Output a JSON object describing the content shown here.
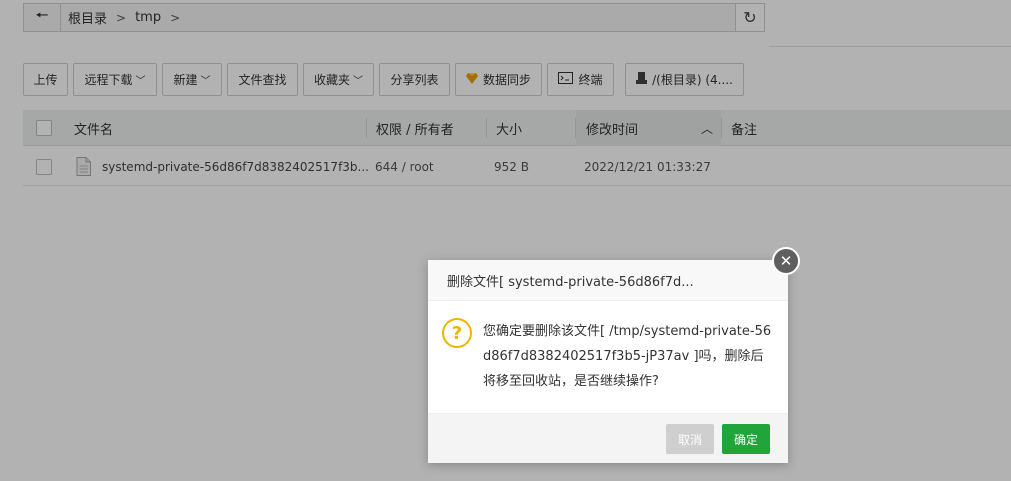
{
  "pathbar": {
    "back_icon": "arrow-left-icon",
    "crumbs": [
      "根目录",
      "tmp"
    ],
    "separator": ">",
    "refresh_icon": "refresh-icon"
  },
  "toolbar": {
    "upload": "上传",
    "remote_download": "远程下载",
    "new": "新建",
    "file_search": "文件查找",
    "favorites": "收藏夹",
    "share_list": "分享列表",
    "data_sync": "数据同步",
    "terminal": "终端",
    "disk": "/(根目录) (4...."
  },
  "table": {
    "headers": {
      "name": "文件名",
      "permission": "权限 / 所有者",
      "size": "大小",
      "modified": "修改时间",
      "note": "备注"
    },
    "rows": [
      {
        "name": "systemd-private-56d86f7d8382402517f3b...",
        "permission": "644 / root",
        "size": "952 B",
        "modified": "2022/12/21 01:33:27",
        "note": ""
      }
    ]
  },
  "dialog": {
    "title": "删除文件[ systemd-private-56d86f7d...",
    "message": "您确定要删除该文件[ /tmp/systemd-private-56d86f7d8382402517f3b5-jP37av ]吗，删除后将移至回收站，是否继续操作?",
    "cancel": "取消",
    "confirm": "确定",
    "icon": "question-icon",
    "close_icon": "close-icon"
  },
  "colors": {
    "accent_green": "#20a53a",
    "warning_yellow": "#f0b400",
    "sync_icon": "#f0a000"
  }
}
